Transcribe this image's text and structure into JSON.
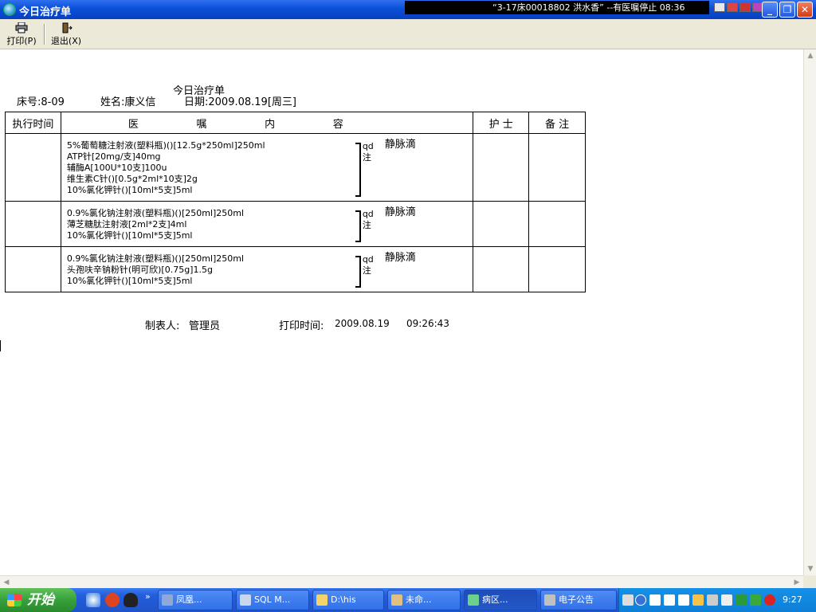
{
  "window": {
    "title": "今日治疗单",
    "notice": "“3-17床00018802 洪水香” --有医嘱停止 08:36"
  },
  "toolbar": {
    "print_label": "打印(P)",
    "exit_label": "退出(X)"
  },
  "document": {
    "title": "今日治疗单",
    "bed": "床号:8-09",
    "name": "姓名:康义信",
    "date": "日期:2009.08.19[周三]",
    "headers": {
      "time": "执行时间",
      "content": [
        "医",
        "嘱",
        "内",
        "容"
      ],
      "nurse": "护 士",
      "remark": "备 注"
    },
    "groups": [
      {
        "time": "",
        "drugs": [
          "5%葡萄糖注射液(塑料瓶)()[12.5g*250ml]250ml",
          "ATP针[20mg/支]40mg",
          "辅酶A[100U*10支]100u",
          "维生素C针()[0.5g*2ml*10支]2g",
          "10%氯化钾针()[10ml*5支]5ml"
        ],
        "freq": [
          "qd",
          "注"
        ],
        "route": "静脉滴",
        "nurse": "",
        "remark": ""
      },
      {
        "time": "",
        "drugs": [
          "0.9%氯化钠注射液(塑料瓶)()[250ml]250ml",
          "薄芝糖肽注射液[2ml*2支]4ml",
          "10%氯化钾针()[10ml*5支]5ml"
        ],
        "freq": [
          "qd",
          "注"
        ],
        "route": "静脉滴",
        "nurse": "",
        "remark": ""
      },
      {
        "time": "",
        "drugs": [
          "0.9%氯化钠注射液(塑料瓶)()[250ml]250ml",
          "头孢呋辛钠粉针(明可欣)[0.75g]1.5g",
          "10%氯化钾针()[10ml*5支]5ml"
        ],
        "freq": [
          "qd",
          "注"
        ],
        "route": "静脉滴",
        "nurse": "",
        "remark": ""
      }
    ],
    "maker_label": "制表人:",
    "maker": "管理员",
    "print_time_label": "打印时间:",
    "print_date": "2009.08.19",
    "print_time": "09:26:43"
  },
  "taskbar": {
    "start_label": "开始",
    "tasks": [
      {
        "label": "凤凰...",
        "icon": "browser-icon",
        "color": "#8fa8d8"
      },
      {
        "label": "SQL M...",
        "icon": "sql-icon",
        "color": "#c9d6ee"
      },
      {
        "label": "D:\\his",
        "icon": "folder-icon",
        "color": "#f3d36a"
      },
      {
        "label": "未命...",
        "icon": "paint-icon",
        "color": "#e0c080"
      },
      {
        "label": "病区...",
        "icon": "app-icon",
        "color": "#6ccf8a"
      },
      {
        "label": "电子公告",
        "icon": "notice-icon",
        "color": "#c0c0c0"
      }
    ],
    "clock": "9:27"
  },
  "colors": {
    "titlebar": "#0a4fd8",
    "toolbar": "#ece9d8",
    "taskbar": "#245edb",
    "start": "#36a03a",
    "tray": "#0f7fd8"
  }
}
